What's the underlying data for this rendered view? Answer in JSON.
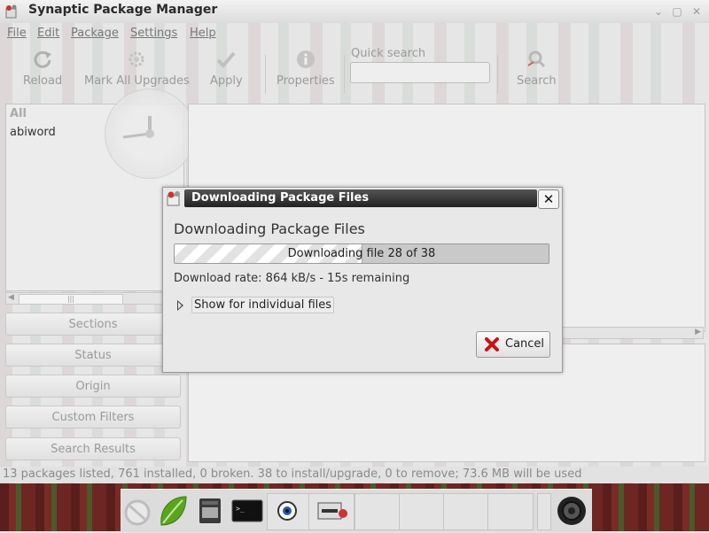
{
  "window": {
    "title": "Synaptic Package Manager",
    "controls": [
      "chevron-down-icon",
      "restore-icon",
      "close-icon"
    ]
  },
  "menu": {
    "items": [
      "File",
      "Edit",
      "Package",
      "Settings",
      "Help"
    ]
  },
  "toolbar": {
    "reload": "Reload",
    "mark_all_upgrades": "Mark All Upgrades",
    "apply": "Apply",
    "properties": "Properties",
    "quick_search_label": "Quick search",
    "quick_search_value": "",
    "search": "Search"
  },
  "sidebar": {
    "header": "All",
    "items": [
      "abiword"
    ]
  },
  "filters": {
    "sections": "Sections",
    "status": "Status",
    "origin": "Origin",
    "custom_filters": "Custom Filters",
    "search_results": "Search Results"
  },
  "statusbar": {
    "text": "13 packages listed, 761 installed, 0 broken. 38 to install/upgrade, 0 to remove; 73.6 MB will be used"
  },
  "dialog": {
    "title": "Downloading Package Files",
    "heading": "Downloading Package Files",
    "progress_text": "Downloading file 28 of 38",
    "progress_fraction": 0.5,
    "rate_text": "Download rate: 864 kB/s - 15s remaining",
    "expander_label": "Show for individual files",
    "cancel_label": "Cancel"
  },
  "colors": {
    "dialog_titlebar": "#222222",
    "cancel_icon": "#cc1111",
    "taskbar": "#5a1f1c"
  },
  "dock": {
    "icons": [
      "clock-icon",
      "leaf-app-icon",
      "file-manager-icon",
      "terminal-icon",
      "eye-app-icon",
      "synaptic-icon",
      "speaker-icon"
    ]
  }
}
